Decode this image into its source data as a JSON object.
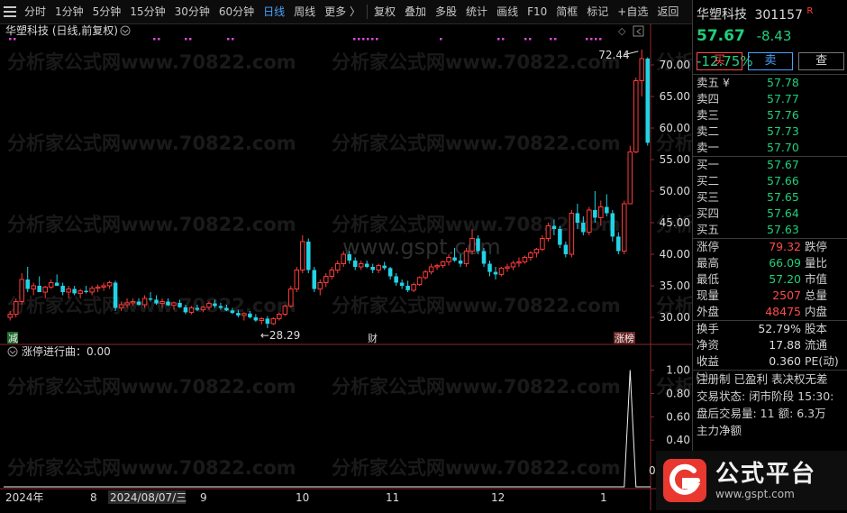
{
  "toolbar": {
    "periods": [
      "分时",
      "1分钟",
      "5分钟",
      "15分钟",
      "30分钟",
      "60分钟",
      "日线",
      "周线",
      "更多 〉"
    ],
    "active_index": 6,
    "actions": [
      "复权",
      "叠加",
      "多股",
      "统计",
      "画线",
      "F10",
      "简框",
      "标记",
      "+自选",
      "返回"
    ]
  },
  "chart": {
    "title": "华塑科技 (日线,前复权)",
    "high_label": "72.44",
    "low_label": "←28.29",
    "y_ticks": [
      "70.00",
      "65.00",
      "60.00",
      "55.00",
      "50.00",
      "45.00",
      "40.00",
      "35.00",
      "30.00"
    ],
    "markers": {
      "left": "减",
      "mid": "财",
      "right": "涨榜"
    },
    "indicator_title": "涨停进行曲：0.00",
    "indicator_ticks": [
      "1.00",
      "0.80",
      "0.60",
      "0.40"
    ],
    "indicator_zero": "0.",
    "x_labels": [
      "2024年",
      "8",
      "2024/08/07/三",
      "9",
      "10",
      "11",
      "12",
      "1"
    ],
    "watermark_main": "www.gspt.com",
    "watermark_repeat": "分析家公式网www.70822.com"
  },
  "chart_data": {
    "type": "candlestick",
    "title": "华塑科技 (日线,前复权)",
    "ylim": [
      28,
      74
    ],
    "candles": [
      [
        30,
        31,
        29.5,
        30.5
      ],
      [
        30.5,
        33,
        30,
        32.5
      ],
      [
        32.5,
        37,
        32,
        36
      ],
      [
        36,
        38,
        34,
        34.5
      ],
      [
        34.5,
        35.5,
        33.5,
        35
      ],
      [
        35,
        36.5,
        34,
        34
      ],
      [
        34,
        35,
        33,
        34.8
      ],
      [
        34.8,
        36,
        34.5,
        35.5
      ],
      [
        35.5,
        36.8,
        35,
        35
      ],
      [
        35,
        35.5,
        33.5,
        34
      ],
      [
        34,
        35,
        33,
        34.5
      ],
      [
        34.5,
        35,
        33.5,
        33.8
      ],
      [
        33.8,
        34.5,
        33,
        34.2
      ],
      [
        34.2,
        35,
        33.8,
        34
      ],
      [
        34,
        35,
        33.5,
        34.6
      ],
      [
        34.6,
        35.2,
        34,
        34.8
      ],
      [
        34.8,
        35.5,
        34.2,
        35
      ],
      [
        35,
        35.8,
        34.5,
        35.5
      ],
      [
        35.5,
        35.8,
        31,
        31.5
      ],
      [
        31.5,
        32.5,
        31,
        32
      ],
      [
        32,
        33,
        31.5,
        32.3
      ],
      [
        32.3,
        33,
        31.8,
        32.5
      ],
      [
        32.5,
        33,
        31.8,
        32
      ],
      [
        32,
        33.5,
        31.5,
        33
      ],
      [
        33,
        34,
        32.5,
        32.8
      ],
      [
        32.8,
        33.5,
        32,
        32.2
      ],
      [
        32.2,
        33,
        31.5,
        32.5
      ],
      [
        32.5,
        33,
        31.8,
        31.9
      ],
      [
        31.9,
        32.5,
        31.2,
        32.3
      ],
      [
        32.3,
        32.8,
        31.5,
        31.6
      ],
      [
        31.6,
        32,
        30.5,
        30.8
      ],
      [
        30.8,
        31.8,
        30.5,
        31.5
      ],
      [
        31.5,
        32,
        31,
        31.2
      ],
      [
        31.2,
        31.8,
        30.8,
        31.6
      ],
      [
        31.6,
        32.5,
        31.2,
        32.2
      ],
      [
        32.2,
        32.8,
        31.5,
        31.8
      ],
      [
        31.8,
        32.3,
        31.2,
        31.5
      ],
      [
        31.5,
        32,
        31,
        31.1
      ],
      [
        31.1,
        31.5,
        30.5,
        30.7
      ],
      [
        30.7,
        31.2,
        30,
        30.3
      ],
      [
        30.3,
        30.8,
        29.5,
        30.6
      ],
      [
        30.6,
        31,
        29.8,
        30
      ],
      [
        30,
        30.5,
        29.3,
        29.5
      ],
      [
        29.5,
        30,
        28.9,
        29.8
      ],
      [
        29.8,
        30.2,
        28.29,
        29
      ],
      [
        29,
        30,
        28.8,
        29.8
      ],
      [
        29.8,
        30.8,
        29.5,
        30.5
      ],
      [
        30.5,
        32,
        30.2,
        31.8
      ],
      [
        31.8,
        35,
        31.5,
        34.5
      ],
      [
        34.5,
        38,
        34,
        37.5
      ],
      [
        37.5,
        43,
        37,
        42
      ],
      [
        42,
        42.5,
        37,
        37.5
      ],
      [
        37.5,
        38,
        34,
        34.5
      ],
      [
        34.5,
        36,
        33.5,
        35.5
      ],
      [
        35.5,
        37,
        34.8,
        36.5
      ],
      [
        36.5,
        38,
        36,
        37.5
      ],
      [
        37.5,
        39,
        37,
        38.5
      ],
      [
        38.5,
        40.5,
        38,
        40
      ],
      [
        40,
        40.5,
        38.5,
        39
      ],
      [
        39,
        39.5,
        37.5,
        38
      ],
      [
        38,
        39,
        37.5,
        38.5
      ],
      [
        38.5,
        39,
        37.8,
        38
      ],
      [
        38,
        38.5,
        37,
        37.5
      ],
      [
        37.5,
        38.5,
        37,
        38.2
      ],
      [
        38.2,
        38.8,
        37.5,
        37.8
      ],
      [
        37.8,
        38,
        36,
        36.5
      ],
      [
        36.5,
        37,
        35,
        35.5
      ],
      [
        35.5,
        36,
        34.5,
        35
      ],
      [
        35,
        35.8,
        34,
        34.3
      ],
      [
        34.3,
        35.5,
        34,
        35.2
      ],
      [
        35.2,
        36.5,
        35,
        36.3
      ],
      [
        36.3,
        37.5,
        36,
        37.2
      ],
      [
        37.2,
        38.5,
        36.8,
        38
      ],
      [
        38,
        38.5,
        37.5,
        38.2
      ],
      [
        38.2,
        39,
        37.8,
        38.8
      ],
      [
        38.8,
        40,
        38.2,
        39.5
      ],
      [
        39.5,
        41,
        38.8,
        39
      ],
      [
        39,
        40,
        38,
        38.5
      ],
      [
        38.5,
        41,
        38,
        40.5
      ],
      [
        40.5,
        44,
        40,
        42.5
      ],
      [
        42.5,
        43,
        40,
        40.5
      ],
      [
        40.5,
        41,
        38,
        38.5
      ],
      [
        38.5,
        39,
        36.5,
        37.2
      ],
      [
        37.2,
        38,
        36,
        36.8
      ],
      [
        36.8,
        38,
        36.5,
        37.8
      ],
      [
        37.8,
        38.5,
        37.2,
        38
      ],
      [
        38,
        39,
        37.5,
        38.6
      ],
      [
        38.6,
        39.5,
        38,
        38.8
      ],
      [
        38.8,
        39.8,
        38.5,
        39.5
      ],
      [
        39.5,
        40.5,
        39,
        40.2
      ],
      [
        40.2,
        41,
        39.5,
        40.8
      ],
      [
        40.8,
        43,
        40.5,
        42.5
      ],
      [
        42.5,
        45,
        42,
        44.5
      ],
      [
        44.5,
        45.5,
        43,
        44
      ],
      [
        44,
        44.5,
        41,
        41.5
      ],
      [
        41.5,
        42,
        39.5,
        40
      ],
      [
        40,
        47,
        39.5,
        46.5
      ],
      [
        46.5,
        48,
        44,
        45
      ],
      [
        45,
        46,
        43,
        43.5
      ],
      [
        43.5,
        47.5,
        43,
        47
      ],
      [
        47,
        50,
        45,
        45.8
      ],
      [
        45.8,
        48.5,
        44.5,
        47.5
      ],
      [
        47.5,
        49.5,
        46,
        46.5
      ],
      [
        46.5,
        47,
        42,
        42.8
      ],
      [
        42.8,
        43.5,
        40,
        40.5
      ],
      [
        40.5,
        48.5,
        40,
        48
      ],
      [
        48,
        57.2,
        48,
        56.2
      ],
      [
        56.2,
        68,
        56,
        67.5
      ],
      [
        67.5,
        72.44,
        65,
        71
      ],
      [
        71,
        71.2,
        57.2,
        57.67
      ]
    ],
    "indicator": {
      "title": "涨停进行曲：0.00",
      "values_nonzero": {
        "index": 106,
        "value": 1.0
      },
      "ylim": [
        0,
        1.05
      ]
    },
    "x_labels": [
      "2024年",
      "8",
      "2024/08/07/三",
      "9",
      "10",
      "11",
      "12",
      "1"
    ]
  },
  "panel": {
    "name": "华塑科技",
    "code": "301157",
    "tag": "R",
    "price": "57.67",
    "change": "-8.43",
    "pct": "-12.75%",
    "buy_label": "买",
    "sell_label": "卖",
    "query_label": "查",
    "asks": [
      {
        "label": "卖五 ¥",
        "val": "57.78"
      },
      {
        "label": "卖四",
        "val": "57.77"
      },
      {
        "label": "卖三",
        "val": "57.76"
      },
      {
        "label": "卖二",
        "val": "57.73"
      },
      {
        "label": "卖一",
        "val": "57.70"
      }
    ],
    "bids": [
      {
        "label": "买一",
        "val": "57.67"
      },
      {
        "label": "买二",
        "val": "57.66"
      },
      {
        "label": "买三",
        "val": "57.65"
      },
      {
        "label": "买四",
        "val": "57.64"
      },
      {
        "label": "买五",
        "val": "57.63"
      }
    ],
    "stats1": [
      {
        "l": "涨停",
        "v": "79.32",
        "c": "red",
        "l2": "跌停"
      },
      {
        "l": "最高",
        "v": "66.09",
        "c": "green",
        "l2": "量比"
      },
      {
        "l": "最低",
        "v": "57.20",
        "c": "green",
        "l2": "市值"
      },
      {
        "l": "现量",
        "v": "2507",
        "c": "red",
        "l2": "总量"
      },
      {
        "l": "外盘",
        "v": "48475",
        "c": "red",
        "l2": "内盘"
      }
    ],
    "stats2": [
      {
        "l": "换手",
        "v": "52.79%",
        "c": "white",
        "l2": "股本"
      },
      {
        "l": "净资",
        "v": "17.88",
        "c": "white",
        "l2": "流通"
      },
      {
        "l": "收益㈡",
        "v": "0.360",
        "c": "white",
        "l2": "PE(动)"
      }
    ],
    "extra": [
      "注册制 已盈利 表决权无差",
      "交易状态: 闭市阶段 15:30:",
      "盘后交易量: 11  额: 6.3万",
      "主力净额"
    ]
  },
  "badge": {
    "title": "公式平台",
    "url": "www.gspt.com"
  },
  "colors": {
    "up": "#ff3b3b",
    "down": "#22d3e6",
    "green": "#1fd07a",
    "accent": "#4aa3ff"
  }
}
